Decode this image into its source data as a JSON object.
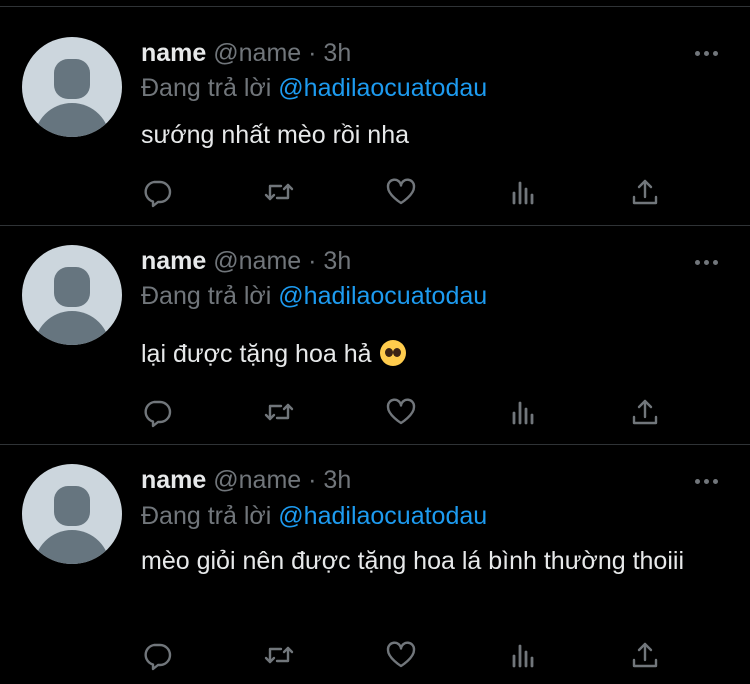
{
  "tweets": [
    {
      "display_name": "name",
      "handle": "@name",
      "separator": "·",
      "time": "3h",
      "replying_prefix": "Đang trả lời",
      "replying_to": "@hadilaocuatodau",
      "text": "sướng nhất mèo rồi nha"
    },
    {
      "display_name": "name",
      "handle": "@name",
      "separator": "·",
      "time": "3h",
      "replying_prefix": "Đang trả lời",
      "replying_to": "@hadilaocuatodau",
      "text": "lại được tặng hoa hả",
      "emoji": "pleading-face-emoji"
    },
    {
      "display_name": "name",
      "handle": "@name",
      "separator": "·",
      "time": "3h",
      "replying_prefix": "Đang trả lời",
      "replying_to": "@hadilaocuatodau",
      "text": "mèo giỏi nên được tặng hoa lá bình thường thoiii"
    }
  ],
  "icons": [
    "reply-icon",
    "retweet-icon",
    "like-icon",
    "analytics-icon",
    "share-icon",
    "more-icon"
  ],
  "colors": {
    "background": "#000000",
    "text": "#e7e9ea",
    "secondary": "#71767b",
    "accent": "#1d9bf0",
    "divider": "#2f3336"
  }
}
